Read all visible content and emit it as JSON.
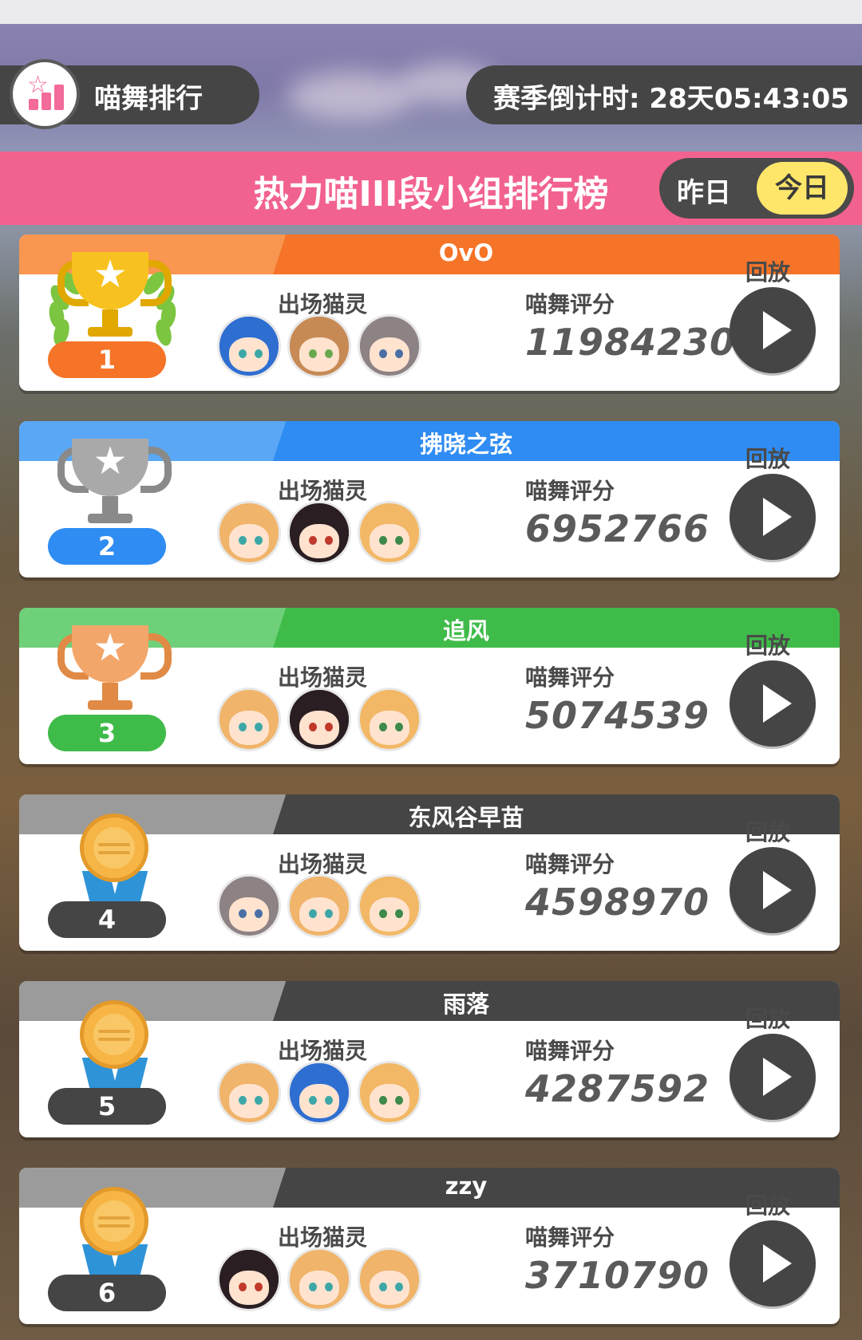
{
  "header": {
    "left_title": "喵舞排行",
    "countdown": "赛季倒计时: 28天05:43:05"
  },
  "banner": {
    "title": "热力喵III段小组排行榜",
    "toggle_yesterday": "昨日",
    "toggle_today": "今日",
    "selected": "今日"
  },
  "labels": {
    "characters": "出场猫灵",
    "score": "喵舞评分",
    "replay": "回放"
  },
  "entries": [
    {
      "rank": "1",
      "name": "OvO",
      "score": "11984230",
      "badge": "gold-trophy-icon",
      "color": "#f57428",
      "light": "#f99650"
    },
    {
      "rank": "2",
      "name": "拂晓之弦",
      "score": "6952766",
      "badge": "silver-trophy-icon",
      "color": "#2f8cf2",
      "light": "#5aa8f5"
    },
    {
      "rank": "3",
      "name": "追风",
      "score": "5074539",
      "badge": "bronze-trophy-icon",
      "color": "#3fbb49",
      "light": "#6fd07a"
    },
    {
      "rank": "4",
      "name": "东风谷早苗",
      "score": "4598970",
      "badge": "medal-icon",
      "color": "#454545",
      "light": "#9b9b9b"
    },
    {
      "rank": "5",
      "name": "雨落",
      "score": "4287592",
      "badge": "medal-icon",
      "color": "#454545",
      "light": "#9b9b9b"
    },
    {
      "rank": "6",
      "name": "zzy",
      "score": "3710790",
      "badge": "medal-icon",
      "color": "#454545",
      "light": "#9b9b9b"
    }
  ],
  "colors": {
    "banner_pink": "#f2628f",
    "today_yellow": "#fde66a",
    "dark_pill": "#454545"
  }
}
